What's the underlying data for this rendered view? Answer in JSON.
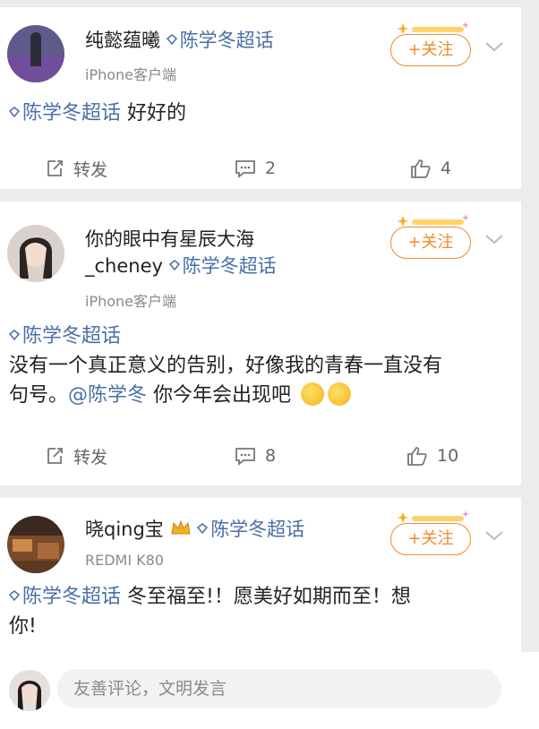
{
  "posts": [
    {
      "user_name": "纯懿蕴曦",
      "name_topic": "陈学冬超话",
      "source": "iPhone客户端",
      "follow_label": "+关注",
      "topic": "陈学冬超话",
      "text": "好好的",
      "repost_label": "转发",
      "comments": "2",
      "likes": "4"
    },
    {
      "user_name_line1": "你的眼中有星辰大海",
      "user_name_line2": "_cheney",
      "name_topic": "陈学冬超话",
      "source": "iPhone客户端",
      "follow_label": "+关注",
      "topic": "陈学冬超话",
      "text_line1": "没有一个真正意义的告别，好像我的青春一直没有",
      "text_line2_a": "句号。",
      "mention": "@陈学冬",
      "text_line2_b": "你今年会出现吧",
      "repost_label": "转发",
      "comments": "8",
      "likes": "10"
    },
    {
      "user_name": "晓qing宝",
      "name_topic": "陈学冬超话",
      "source": "REDMI K80",
      "follow_label": "+关注",
      "topic": "陈学冬超话",
      "text_line1": "冬至福至!！愿美好如期而至！想",
      "text_line2": "你!"
    }
  ],
  "comment_input": {
    "placeholder": "友善评论，文明发言"
  },
  "colors": {
    "accent": "#f08a2e",
    "topic": "#4a6fa5",
    "muted": "#8a8a8a"
  }
}
